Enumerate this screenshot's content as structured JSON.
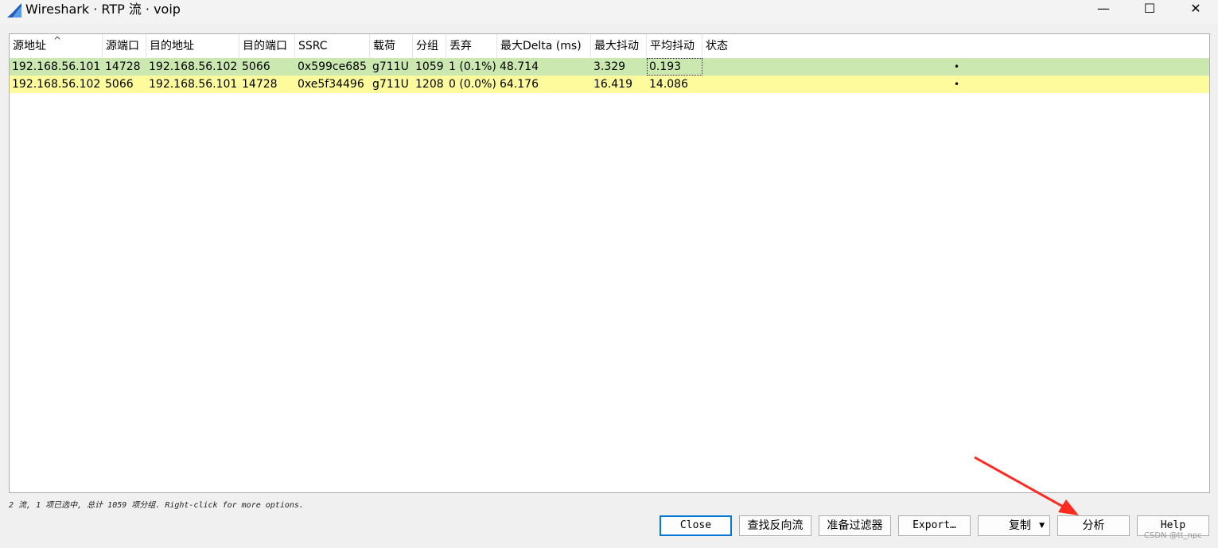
{
  "window": {
    "title": "Wireshark · RTP 流 · voip",
    "minimize_glyph": "—",
    "maximize_glyph": "☐",
    "close_glyph": "✕",
    "icon": "wireshark-fin-icon"
  },
  "table": {
    "columns": [
      "源地址",
      "源端口",
      "目的地址",
      "目的端口",
      "SSRC",
      "载荷",
      "分组",
      "丢弃",
      "最大Delta (ms)",
      "最大抖动",
      "平均抖动",
      "状态"
    ],
    "sort_glyph": "^",
    "rows": [
      [
        "192.168.56.101",
        "14728",
        "192.168.56.102",
        "5066",
        "0x599ce685",
        "g711U",
        "1059",
        "1 (0.1%)",
        "48.714",
        "3.329",
        "0.193",
        "•"
      ],
      [
        "192.168.56.102",
        "5066",
        "192.168.56.101",
        "14728",
        "0xe5f34496",
        "g711U",
        "1208",
        "0 (0.0%)",
        "64.176",
        "16.419",
        "14.086",
        "•"
      ]
    ],
    "row_colors": [
      "#cbe8b1",
      "#fdfb9b"
    ]
  },
  "status_hint": "2 流, 1 项已选中, 总计 1059 项分组. Right-click for more options.",
  "buttons": {
    "close": "Close",
    "find_reverse": "查找反向流",
    "prepare_filter": "准备过滤器",
    "export": "Export…",
    "copy": "复制",
    "analyze": "分析",
    "help": "Help"
  },
  "watermark": "CSDN @tt_npc",
  "colors": {
    "accent": "#0078d7",
    "annotation": "#ff2a1f"
  }
}
